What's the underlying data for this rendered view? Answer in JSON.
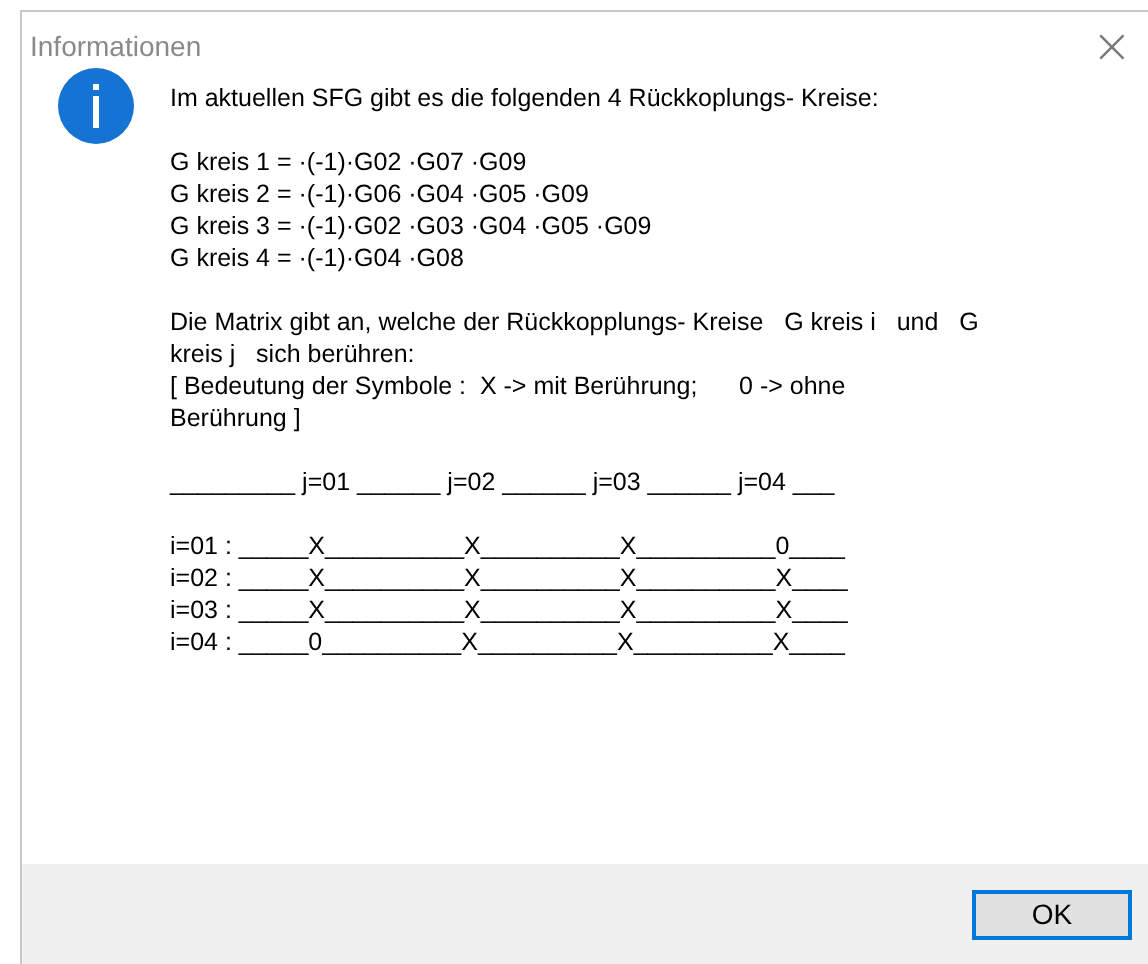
{
  "window": {
    "title": "Informationen",
    "close": "×"
  },
  "message": {
    "intro": "Im aktuellen SFG gibt es die folgenden 4 Rückkoplungs- Kreise:",
    "loops": [
      "G kreis 1 = ·(-1)·G02 ·G07 ·G09",
      "G kreis 2 = ·(-1)·G06 ·G04 ·G05 ·G09",
      "G kreis 3 = ·(-1)·G02 ·G03 ·G04 ·G05 ·G09",
      "G kreis 4 = ·(-1)·G04 ·G08"
    ],
    "description": [
      "Die Matrix gibt an, welche der Rückkopplungs- Kreise   G kreis i   und   G",
      "kreis j   sich berühren:",
      "[ Bedeutung der Symbole :  X -> mit Berührung;      0 -> ohne",
      "Berührung ]"
    ],
    "matrix_header": "_________ j=01 ______ j=02 ______ j=03 ______ j=04 ___",
    "matrix_rows": [
      "i=01 : _____X__________X__________X__________0____",
      "i=02 : _____X__________X__________X__________X____",
      "i=03 : _____X__________X__________X__________X____",
      "i=04 : _____0__________X__________X__________X____"
    ]
  },
  "buttons": [
    "OK"
  ]
}
